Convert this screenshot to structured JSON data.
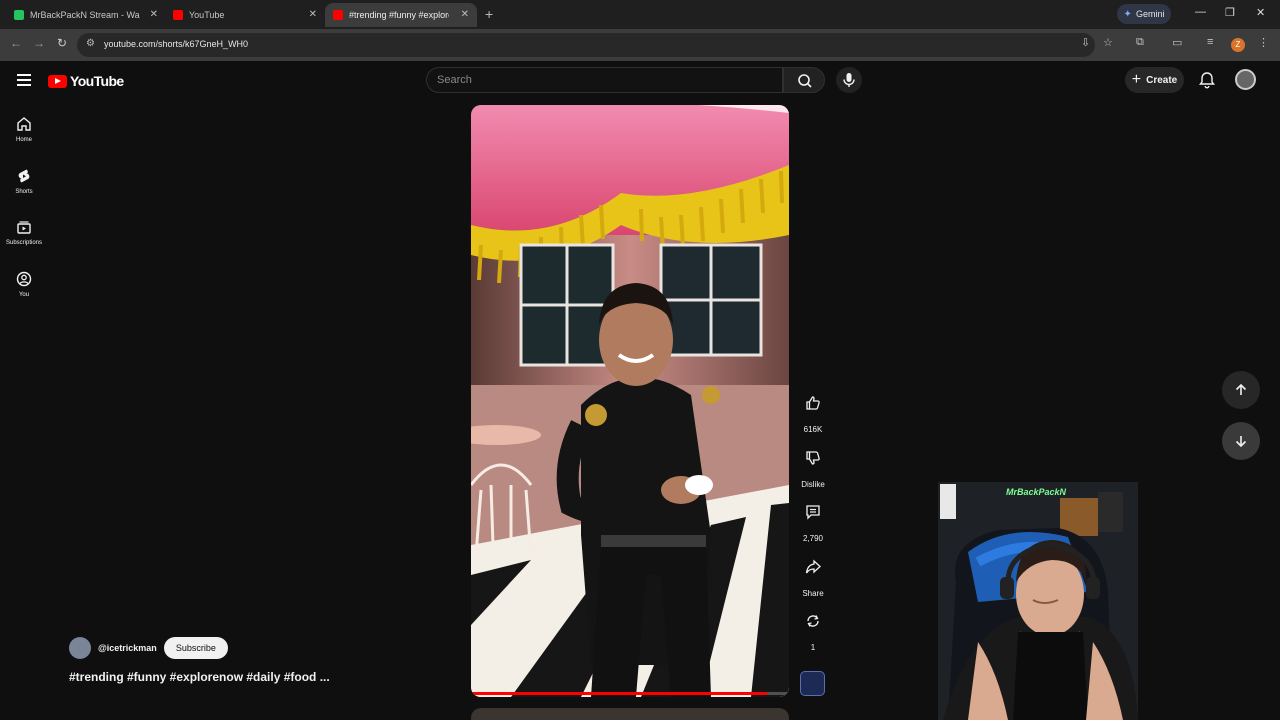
{
  "browser": {
    "tabs": [
      {
        "title": "MrBackPackN Stream - Wa",
        "favicon_color": "#22c55e",
        "active": false
      },
      {
        "title": "YouTube",
        "favicon_color": "#ff0000",
        "active": false
      },
      {
        "title": "#trending #funny #explore",
        "favicon_color": "#ff0000",
        "active": true
      }
    ],
    "gemini_label": "Gemini",
    "url": "youtube.com/shorts/k67GneH_WH0",
    "profile_initial": "Z"
  },
  "masthead": {
    "logo_text": "YouTube",
    "search_placeholder": "Search",
    "create_label": "Create"
  },
  "guide": [
    {
      "label": "Home",
      "icon": "home-icon"
    },
    {
      "label": "Shorts",
      "icon": "shorts-icon"
    },
    {
      "label": "Subscriptions",
      "icon": "subscriptions-icon"
    },
    {
      "label": "You",
      "icon": "you-icon"
    }
  ],
  "short": {
    "channel": "@icetrickman",
    "subscribe_label": "Subscribe",
    "caption": "#trending #funny #explorenow #daily #food ...",
    "progress": 0.93,
    "actions": {
      "like_count": "616K",
      "dislike_label": "Dislike",
      "comment_count": "2,790",
      "share_label": "Share",
      "remix_count": "1"
    }
  },
  "webcam": {
    "overlay_tag": "MrBackPackN"
  },
  "colors": {
    "accent": "#ff0000",
    "background": "#0f0f0f",
    "chip": "#272727"
  }
}
